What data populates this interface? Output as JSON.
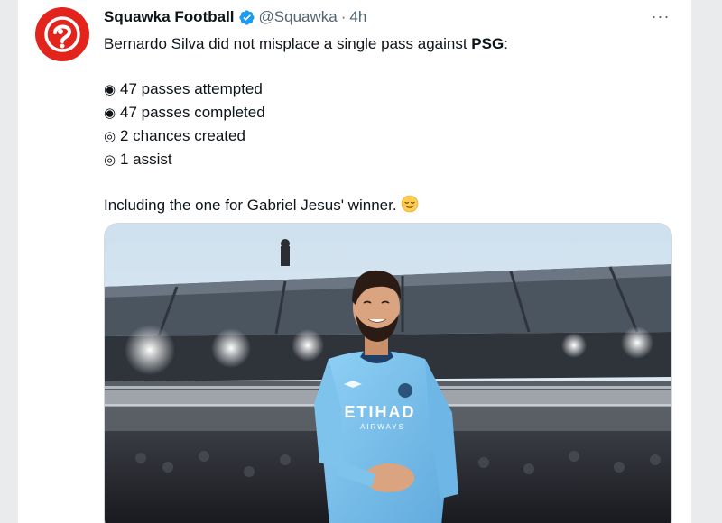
{
  "tweet": {
    "author_name": "Squawka Football",
    "handle": "@Squawka",
    "separator": "·",
    "time": "4h",
    "more_label": "···",
    "text_intro": "Bernardo Silva did not misplace a single pass against ",
    "text_intro_bold": "PSG",
    "text_intro_end": ":",
    "stats": [
      {
        "bullet": "◉",
        "text": "47 passes attempted"
      },
      {
        "bullet": "◉",
        "text": "47 passes completed"
      },
      {
        "bullet": "◎",
        "text": "2 chances created"
      },
      {
        "bullet": "◎",
        "text": "1 assist"
      }
    ],
    "closing": "Including the one for Gabriel Jesus' winner.",
    "emoji": "relieved-face",
    "media": {
      "description_icon": "photo",
      "shirt_sponsor": "ETIHAD",
      "shirt_sponsor_sub": "AIRWAYS"
    }
  },
  "colors": {
    "brand_red": "#e2241c",
    "verified_blue": "#1d9bf0",
    "muted": "#536471",
    "text": "#0f1419",
    "sky_blue": "#7ec3ec"
  }
}
